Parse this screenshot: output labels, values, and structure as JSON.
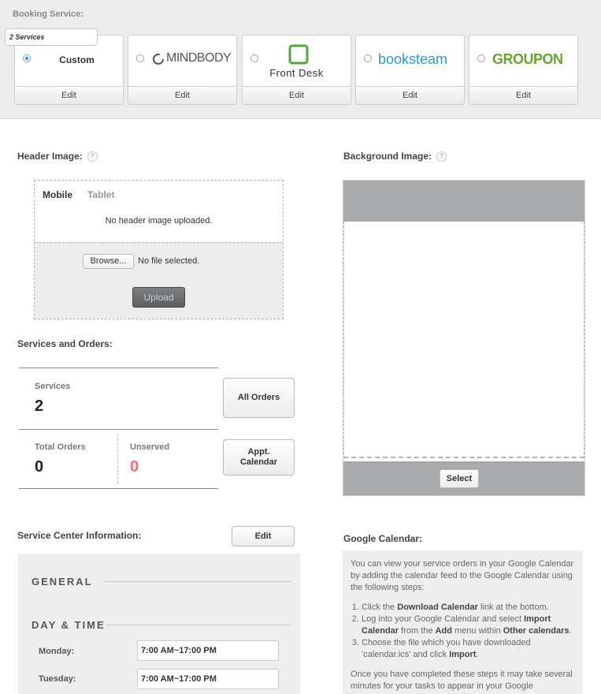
{
  "booking": {
    "label": "Booking Service:",
    "badge": "2 Services",
    "edit_label": "Edit",
    "services": [
      {
        "name": "Custom",
        "selected": true
      },
      {
        "name": "MINDBODY",
        "selected": false
      },
      {
        "name": "Front Desk",
        "selected": false
      },
      {
        "name": "booksteam",
        "selected": false
      },
      {
        "name": "GROUPON",
        "selected": false
      }
    ]
  },
  "header_image": {
    "title": "Header Image:",
    "help": "?",
    "tabs": [
      "Mobile",
      "Tablet"
    ],
    "empty_text": "No header image uploaded.",
    "browse_label": "Browse...",
    "file_status": "No file selected.",
    "upload_label": "Upload"
  },
  "background_image": {
    "title": "Background Image:",
    "help": "?",
    "select_label": "Select"
  },
  "services_orders": {
    "title": "Services and Orders:",
    "services_label": "Services",
    "services_value": "2",
    "total_orders_label": "Total Orders",
    "total_orders_value": "0",
    "unserved_label": "Unserved",
    "unserved_value": "0",
    "all_orders_label": "All Orders",
    "appt_label_line1": "Appt.",
    "appt_label_line2": "Calendar"
  },
  "service_center": {
    "title": "Service Center Information:",
    "edit_label": "Edit",
    "general_heading": "GENERAL",
    "daytime_heading": "DAY & TIME",
    "days": [
      {
        "day": "Monday:",
        "hours": "7:00 AM~17:00 PM"
      },
      {
        "day": "Tuesday:",
        "hours": "7:00 AM~17:00 PM"
      }
    ]
  },
  "google_calendar": {
    "title": "Google Calendar:",
    "intro": "You can view your service orders in your Google Calendar by adding the calendar feed to the Google Calendar using the following steps:",
    "step1_a": "Click the ",
    "step1_b": "Download Calendar",
    "step1_c": " link at the bottom.",
    "step2_a": "Log into your Google Calendar and select ",
    "step2_b": "Import Calendar",
    "step2_c": " from the ",
    "step2_d": "Add",
    "step2_e": " menu within ",
    "step2_f": "Other calendars",
    "step2_g": ".",
    "step3_a": "Choose the file which you have downloaded 'calendar.ics' and click ",
    "step3_b": "Import",
    "step3_c": ".",
    "outro": "Once you have completed these steps it may take several minutes for your tasks to appear in your Google"
  },
  "colors": {
    "unserved": "#f0707a",
    "mindbody": "#f0a020",
    "frontdesk": "#4caa3a",
    "booksteam": "#3399cc",
    "groupon": "#6aa335"
  }
}
